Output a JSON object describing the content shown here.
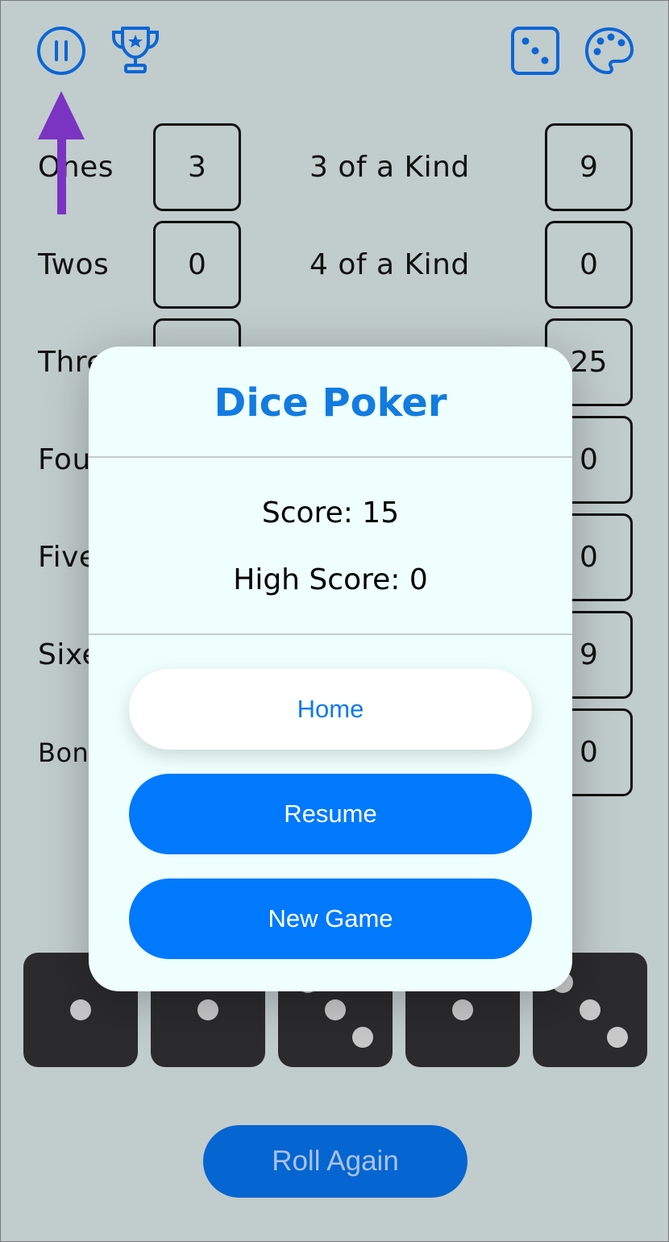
{
  "toolbar": {
    "pause_icon": "pause-circle-icon",
    "trophy_icon": "trophy-icon",
    "dice_icon": "dice-icon",
    "palette_icon": "palette-icon"
  },
  "scorecard": {
    "upper": [
      {
        "label": "Ones",
        "value": "3"
      },
      {
        "label": "Twos",
        "value": "0"
      },
      {
        "label": "Thre",
        "value": ""
      },
      {
        "label": "Fou",
        "value": ""
      },
      {
        "label": "Five",
        "value": ""
      },
      {
        "label": "Sixe",
        "value": ""
      },
      {
        "label": "Bon",
        "value": ""
      }
    ],
    "lower": [
      {
        "label": "3 of a Kind",
        "value": "9"
      },
      {
        "label": "4 of a Kind",
        "value": "0"
      },
      {
        "label": "",
        "value": "25"
      },
      {
        "label": "",
        "value": "0"
      },
      {
        "label": "",
        "value": "0"
      },
      {
        "label": "",
        "value": "9"
      },
      {
        "label": "",
        "value": "0"
      }
    ]
  },
  "dice": [
    1,
    1,
    3,
    1,
    3
  ],
  "roll_button": "Roll Again",
  "modal": {
    "title": "Dice Poker",
    "score": "Score: 15",
    "high_score": "High Score: 0",
    "home_button": "Home",
    "resume_button": "Resume",
    "new_game_button": "New Game"
  },
  "colors": {
    "accent": "#0079fd",
    "annotation_arrow": "#7b34c2"
  }
}
